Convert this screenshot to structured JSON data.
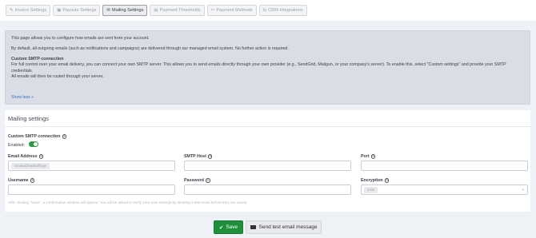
{
  "tabs": [
    {
      "label": "Invoice Settings",
      "icon": "wrench-icon",
      "glyph": "✎",
      "active": false
    },
    {
      "label": "Payouts Settings",
      "icon": "bank-icon",
      "glyph": "▣",
      "active": false
    },
    {
      "label": "Mailing Settings",
      "icon": "envelope-icon",
      "glyph": "✉",
      "active": true
    },
    {
      "label": "Payment Thresholds",
      "icon": "money-icon",
      "glyph": "▤",
      "active": false
    },
    {
      "label": "Payment Methods",
      "icon": "pencil-icon",
      "glyph": "✏",
      "active": false
    },
    {
      "label": "CRM Integrations",
      "icon": "arrows-icon",
      "glyph": "⇆",
      "active": false
    }
  ],
  "info": {
    "p1": "This page allows you to configure how emails are sent from your account.",
    "p2": "By default, all outgoing emails (such as notifications and campaigns) are delivered through our managed email system. No further action is required.",
    "heading": "Custom SMTP connection",
    "p3": "For full control over your email delivery, you can connect your own SMTP server. This allows you to send emails directly through your own provider (e.g., SendGrid, Mailgun, or your company's server). To enable this, select \"Custom settings\" and provide your SMTP credentials.",
    "p4": "All emails will then be routed through your server.",
    "show_less": "Show less »"
  },
  "form": {
    "title": "Mailing settings",
    "smtp_label": "Custom SMTP connection",
    "enabled_label": "Enabled:",
    "enabled": true,
    "email_label": "Email Address",
    "email_value": "mindiq@leadscliff.sys",
    "host_label": "SMTP Host",
    "host_value": "",
    "port_label": "Port",
    "port_value": "",
    "username_label": "Username",
    "username_value": "",
    "password_label": "Password",
    "password_value": "",
    "encryption_label": "Encryption",
    "encryption_value": "none",
    "note": "After clicking \"Save\", a confirmation window will appear. You will be asked to verify your new settings by sending a test email before they are saved."
  },
  "actions": {
    "save_label": "Save",
    "test_label": "Send test email message"
  },
  "colors": {
    "save": "#1f8f3c",
    "toggle_on": "#2e9a43",
    "link": "#3d6fc4"
  }
}
